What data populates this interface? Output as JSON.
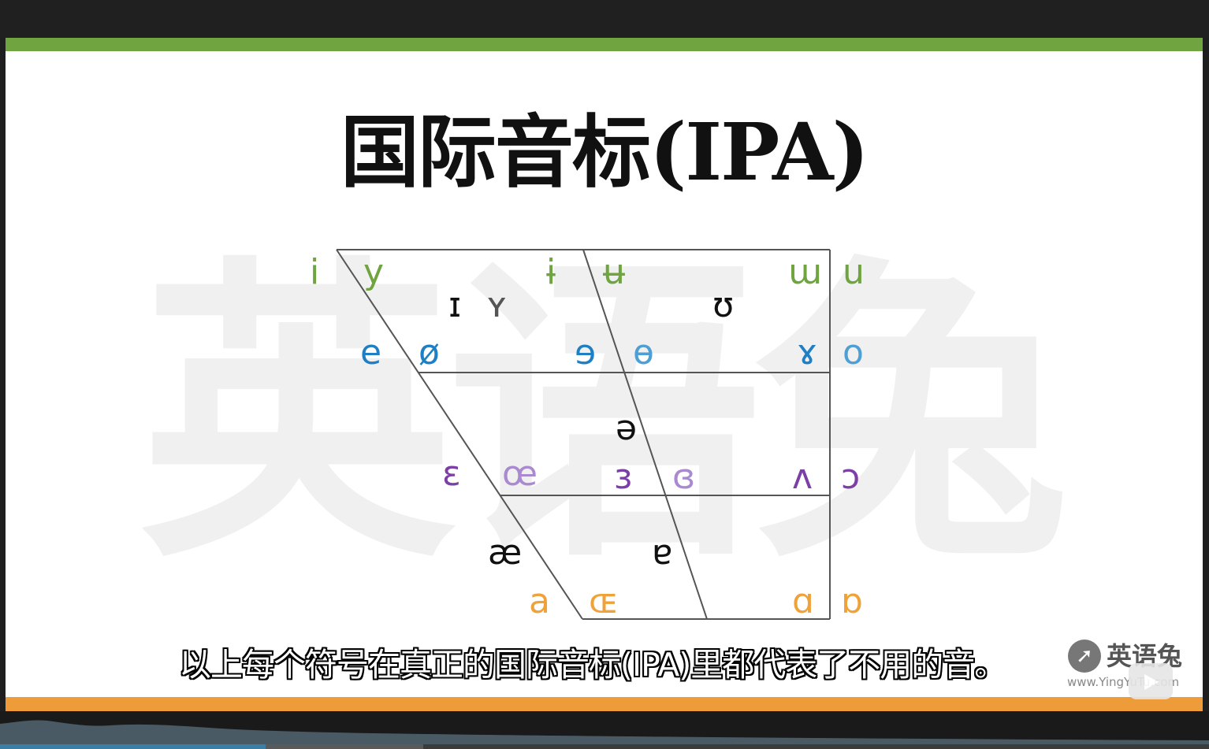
{
  "slide": {
    "title": "国际音标(IPA)",
    "watermark": "英语兔",
    "colors": {
      "green": "#6fa440",
      "blue": "#1f7fc4",
      "purple": "#7b3fa6",
      "light_purple": "#a98ad0",
      "orange": "#f0a23a",
      "black": "#111111",
      "gray": "#555555"
    }
  },
  "vowel_chart": {
    "symbols": [
      {
        "text": "i",
        "color": "#6fa440"
      },
      {
        "text": "y",
        "color": "#6fa440"
      },
      {
        "text": "ɨ",
        "color": "#6fa440"
      },
      {
        "text": "ʉ",
        "color": "#6fa440"
      },
      {
        "text": "ɯ",
        "color": "#6fa440"
      },
      {
        "text": "u",
        "color": "#6fa440"
      },
      {
        "text": "ɪ",
        "color": "#111111"
      },
      {
        "text": "ʏ",
        "color": "#555555"
      },
      {
        "text": "ʊ",
        "color": "#111111"
      },
      {
        "text": "e",
        "color": "#1f7fc4"
      },
      {
        "text": "ø",
        "color": "#1f7fc4"
      },
      {
        "text": "ɘ",
        "color": "#1f7fc4"
      },
      {
        "text": "ɵ",
        "color": "#4f9fd4"
      },
      {
        "text": "ɤ",
        "color": "#1f7fc4"
      },
      {
        "text": "o",
        "color": "#4f9fd4"
      },
      {
        "text": "ə",
        "color": "#111111"
      },
      {
        "text": "ɛ",
        "color": "#7b3fa6"
      },
      {
        "text": "œ",
        "color": "#a98ad0"
      },
      {
        "text": "ɜ",
        "color": "#7b3fa6"
      },
      {
        "text": "ɞ",
        "color": "#a98ad0"
      },
      {
        "text": "ʌ",
        "color": "#7b3fa6"
      },
      {
        "text": "ɔ",
        "color": "#7b3fa6"
      },
      {
        "text": "æ",
        "color": "#111111"
      },
      {
        "text": "ɐ",
        "color": "#111111"
      },
      {
        "text": "a",
        "color": "#f0a23a"
      },
      {
        "text": "ɶ",
        "color": "#f0a23a"
      },
      {
        "text": "ɑ",
        "color": "#f0a23a"
      },
      {
        "text": "ɒ",
        "color": "#f0a23a"
      }
    ]
  },
  "subtitle": "以上每个符号在真正的国际音标(IPA)里都代表了不用的音。",
  "branding": {
    "name": "英语兔",
    "url": "www.YingYuTu.com",
    "icon": "rabbit-logo-icon"
  },
  "player": {
    "progress": 0.22,
    "buffered": 0.35,
    "play_icon": "play-icon"
  }
}
